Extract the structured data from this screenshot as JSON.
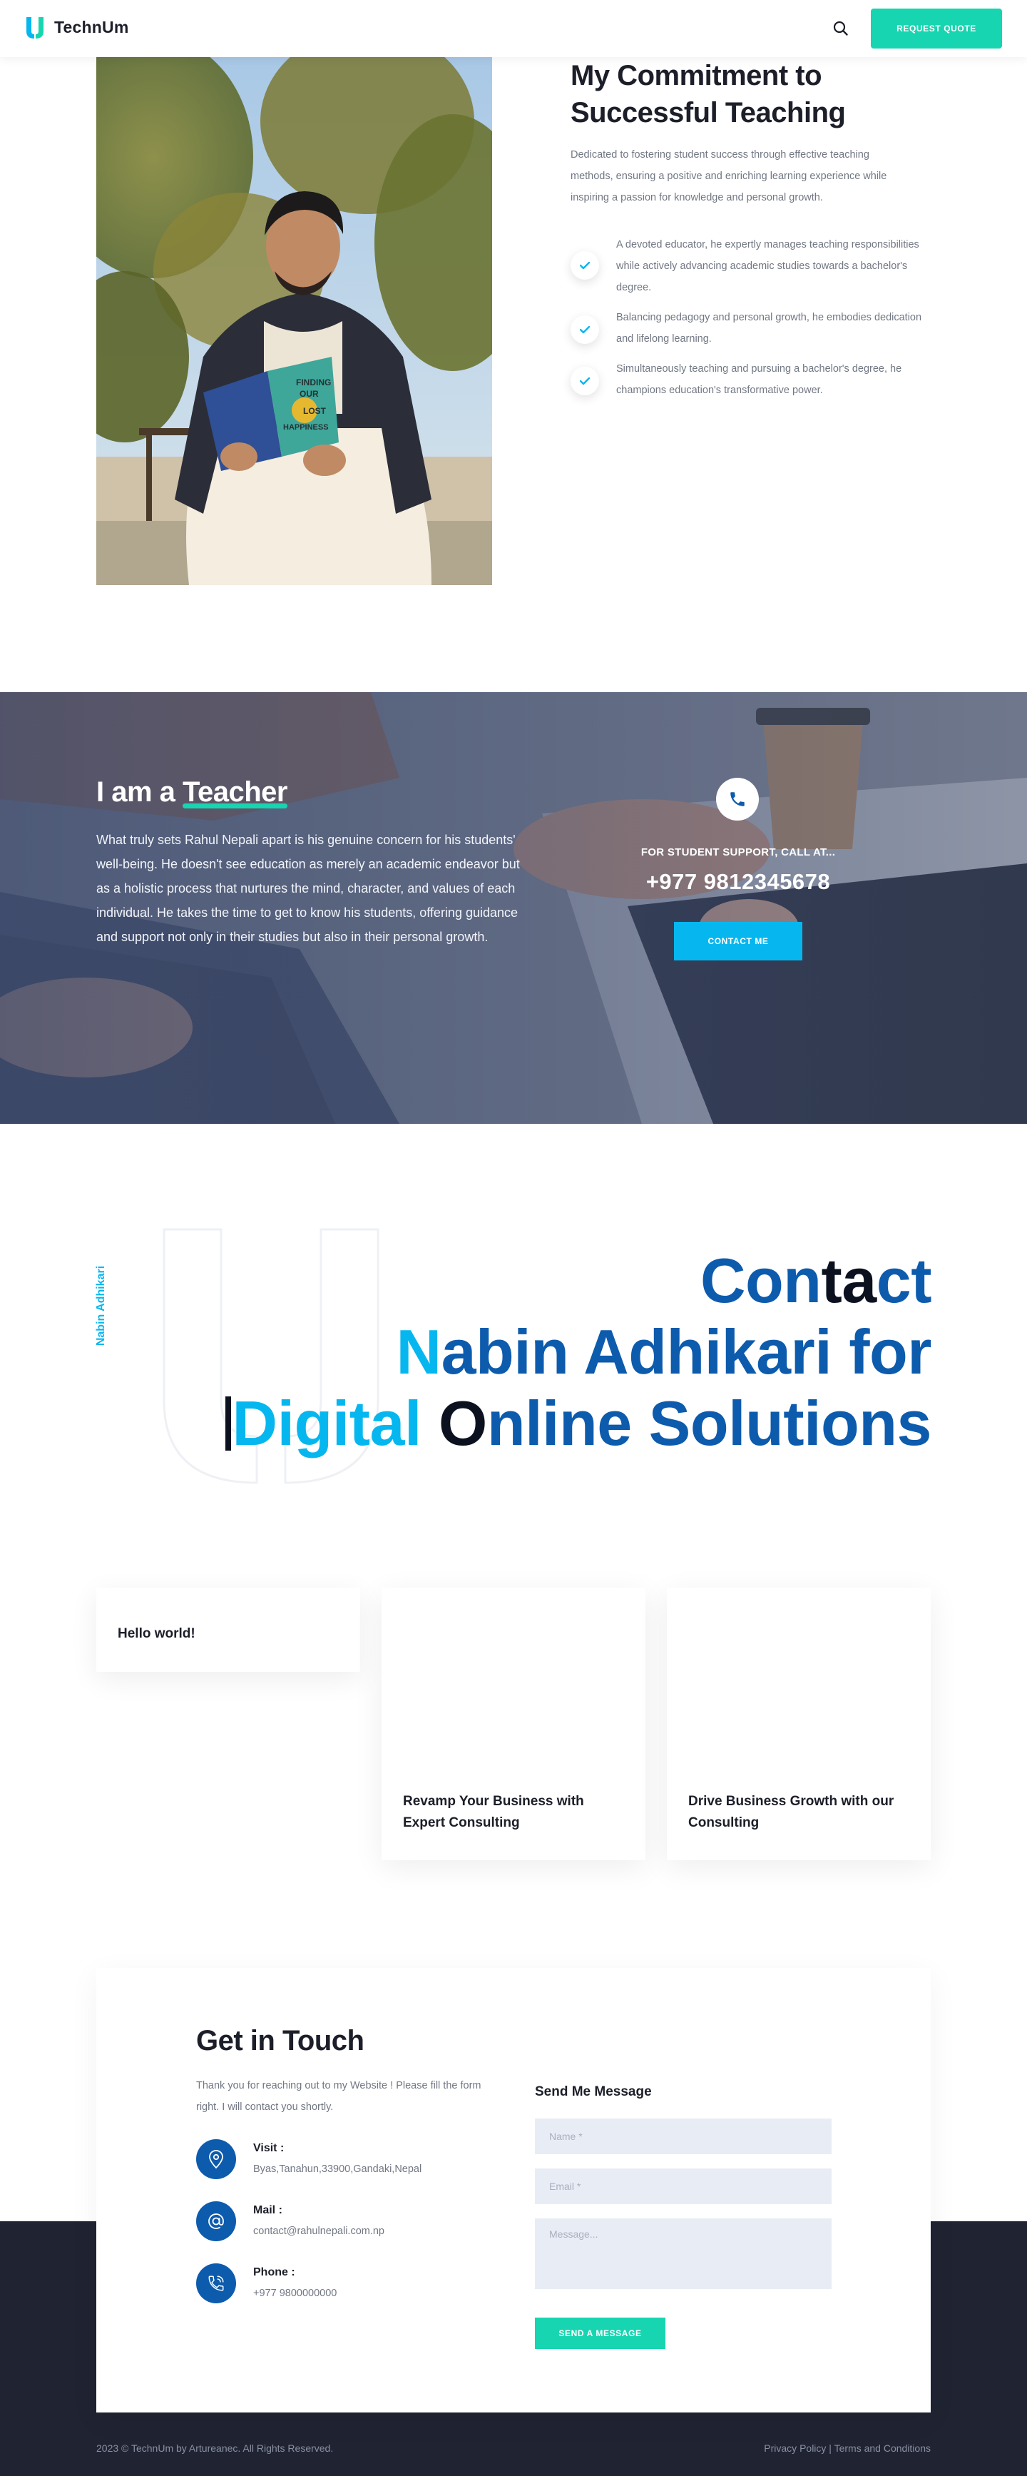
{
  "header": {
    "logo_text": "TechnUm",
    "quote_button": "REQUEST QUOTE"
  },
  "commitment": {
    "title_line1": "My Commitment to",
    "title_line2_plain": "Successful ",
    "title_line2_highlight": "Teaching",
    "description": "Dedicated to fostering student success through effective teaching methods, ensuring a positive and enriching learning experience while inspiring a passion for knowledge and personal growth.",
    "points": [
      "A devoted educator, he expertly manages teaching responsibilities while actively advancing academic studies towards a bachelor's degree.",
      "Balancing pedagogy and personal growth, he embodies dedication and lifelong learning.",
      "Simultaneously teaching and pursuing a bachelor's degree, he champions education's transformative power."
    ],
    "book_cover_words": [
      "FINDING",
      "OUR",
      "LOST",
      "HAPPINESS"
    ]
  },
  "teacher": {
    "title_plain": "I am a ",
    "title_highlight": "Teacher",
    "description": "What truly sets Rahul Nepali apart is his genuine concern for his students' well-being. He doesn't see education as merely an academic endeavor but as a holistic process that nurtures the mind, character, and values of each individual. He takes the time to get to know his students, offering guidance and support not only in their studies but also in their personal growth.",
    "support_label": "FOR STUDENT SUPPORT, CALL AT...",
    "support_phone": "+977 9812345678",
    "contact_button": "CONTACT ME"
  },
  "contact_heading": {
    "side_label": "Nabin Adhikari",
    "line1_a": "Con",
    "line1_b": "ta",
    "line1_c": "ct",
    "line2_a": "N",
    "line2_b": "abin Adhikari for",
    "line3_a": "Digital",
    "line3_b": " ",
    "line3_c": "O",
    "line3_d": "nline Solutions"
  },
  "cards": [
    {
      "title": "Hello world!"
    },
    {
      "title": "Revamp Your Business with Expert Consulting"
    },
    {
      "title": "Drive Business Growth with our Consulting"
    }
  ],
  "get_in_touch": {
    "title_plain": "Get in ",
    "title_highlight": "Touch",
    "description": "Thank you for reaching out to my Website ! Please fill the form right. I will contact you shortly.",
    "visit_label": "Visit :",
    "visit_value": "Byas,Tanahun,33900,Gandaki,Nepal",
    "mail_label": "Mail :",
    "mail_value": "contact@rahulnepali.com.np",
    "phone_label": "Phone :",
    "phone_value": "+977 9800000000",
    "form_title": "Send Me Message",
    "name_placeholder": "Name *",
    "email_placeholder": "Email *",
    "message_placeholder": "Message...",
    "send_button": "SEND A MESSAGE"
  },
  "footer": {
    "copyright": "2023 © TechnUm by Artureanec. All Rights Reserved.",
    "privacy": "Privacy Policy",
    "separator": " | ",
    "terms": "Terms and Conditions"
  },
  "colors": {
    "accent_green": "#17d5b0",
    "accent_cyan": "#06b7ef",
    "brand_blue": "#0d5bad",
    "dark": "#1c1e29",
    "footer_bg": "#1f2332"
  }
}
